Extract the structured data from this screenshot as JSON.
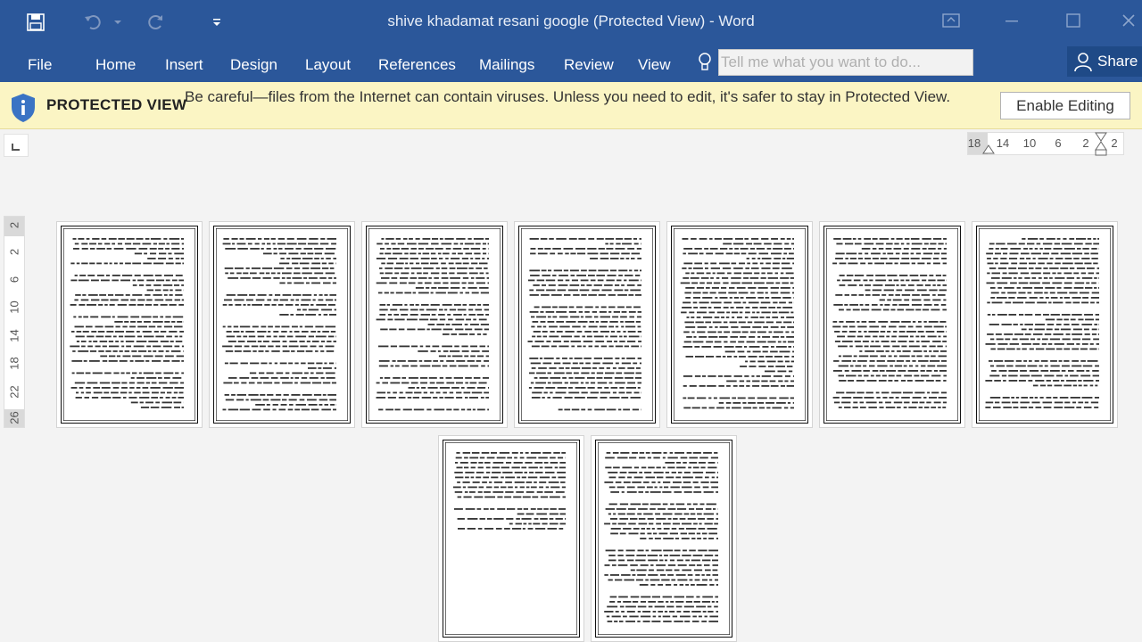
{
  "window": {
    "title": "shive khadamat resani google (Protected View) - Word"
  },
  "ribbon": {
    "tabs": [
      "File",
      "Home",
      "Insert",
      "Design",
      "Layout",
      "References",
      "Mailings",
      "Review",
      "View"
    ],
    "tellme_placeholder": "Tell me what you want to do...",
    "share_label": "Share"
  },
  "protected_view": {
    "label": "PROTECTED VIEW",
    "message": "Be careful—files from the Internet can contain viruses. Unless you need to edit, it's safer to stay in Protected View.",
    "enable_button": "Enable Editing"
  },
  "ruler": {
    "horizontal": [
      "18",
      "14",
      "10",
      "6",
      "2",
      "2"
    ],
    "vertical": [
      "2",
      "2",
      "6",
      "10",
      "14",
      "18",
      "22",
      "26"
    ]
  },
  "document": {
    "page_count": 9
  },
  "colors": {
    "title_bar": "#2b579a",
    "protected_bar": "#fbf5c4",
    "canvas": "#f3f3f3"
  },
  "icons": [
    "save-icon",
    "undo-icon",
    "redo-icon",
    "customize-qat-icon",
    "ribbon-display-icon",
    "minimize-icon",
    "maximize-icon",
    "close-icon",
    "lightbulb-icon",
    "person-icon",
    "info-shield-icon",
    "tab-stop-icon"
  ]
}
